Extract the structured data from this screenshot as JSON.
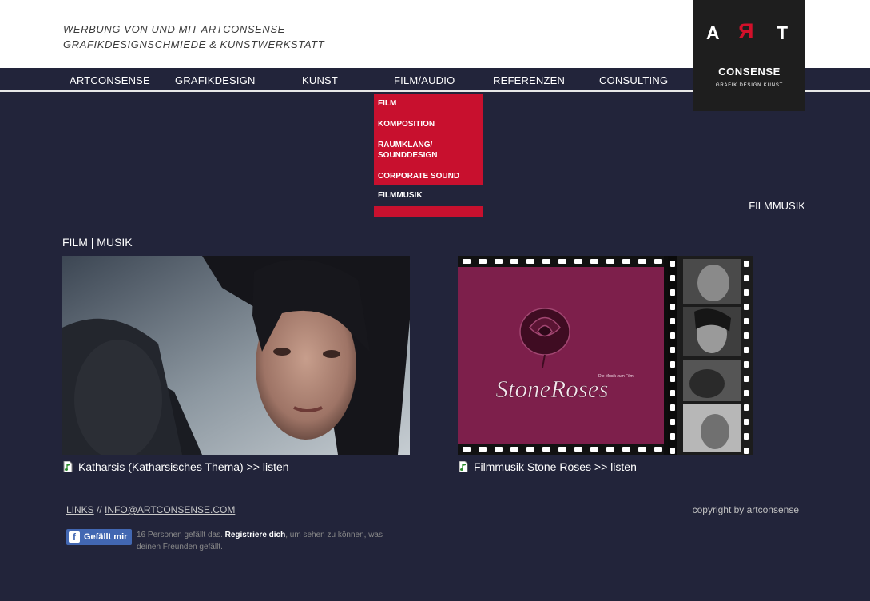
{
  "header": {
    "tagline_line1": "WERBUNG VON UND MIT ARTCONSENSE",
    "tagline_line2": "GRAFIKDESIGNSCHMIEDE & KUNSTWERKSTATT"
  },
  "logo": {
    "letter_a": "A",
    "letter_r": "R",
    "letter_t": "T",
    "name": "CONSENSE",
    "subtitle": "GRAFIK DESIGN KUNST"
  },
  "nav": {
    "items": [
      {
        "label": "ARTCONSENSE"
      },
      {
        "label": "GRAFIKDESIGN"
      },
      {
        "label": "KUNST"
      },
      {
        "label": "FILM/AUDIO"
      },
      {
        "label": "REFERENZEN"
      },
      {
        "label": "CONSULTING"
      }
    ]
  },
  "dropdown": {
    "items": [
      {
        "label": "FILM"
      },
      {
        "label": "KOMPOSITION"
      },
      {
        "label": "RAUMKLANG/ SOUNDDESIGN"
      },
      {
        "label": "CORPORATE SOUND"
      },
      {
        "label": "FILMMUSIK",
        "active": true
      }
    ]
  },
  "breadcrumb": "FILMMUSIK",
  "section_title": "FILM | MUSIK",
  "media": {
    "stone_roses_title": "StoneRoses",
    "stone_roses_caption": "Die Musik zum Film."
  },
  "tracks": [
    {
      "label": "Katharsis (Katharsisches Thema) >> listen",
      "icon": "music-file-icon"
    },
    {
      "label": "Filmmusik Stone Roses >> listen",
      "icon": "music-file-icon"
    }
  ],
  "footer": {
    "links_label": "LINKS",
    "separator": "//",
    "email_label": "INFO@ARTCONSENSE.COM",
    "copyright": "copyright by artconsense"
  },
  "facebook": {
    "icon": "f",
    "button_label": "Gefällt mir",
    "count_text": "16 Personen gefällt das.",
    "register_label": "Registriere dich",
    "rest_text": ", um sehen zu können, was deinen Freunden gefällt."
  },
  "colors": {
    "background": "#22243a",
    "accent_red": "#c8102e",
    "logo_bg": "#1e1e1e",
    "facebook_blue": "#4267b2"
  }
}
